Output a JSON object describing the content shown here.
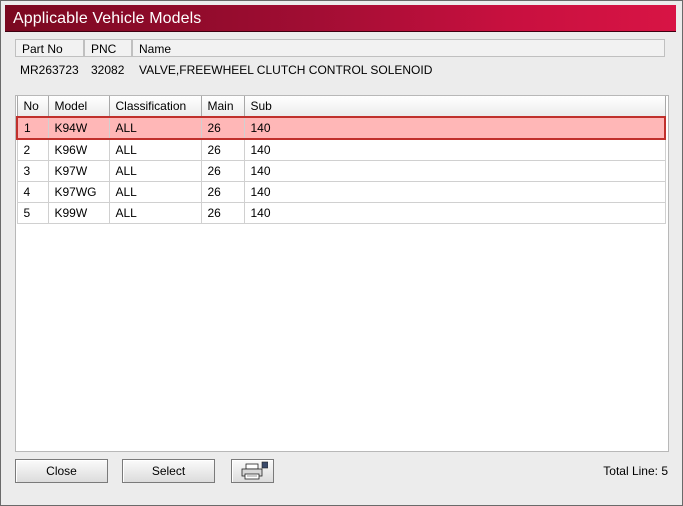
{
  "window": {
    "title": "Applicable Vehicle Models"
  },
  "part_header": {
    "columns": [
      "Part No",
      "PNC",
      "Name"
    ],
    "part_no": "MR263723",
    "pnc": "32082",
    "name": "VALVE,FREEWHEEL CLUTCH CONTROL SOLENOID"
  },
  "table": {
    "columns": [
      "No",
      "Model",
      "Classification",
      "Main",
      "Sub"
    ],
    "rows": [
      {
        "no": "1",
        "model": "K94W",
        "classification": "ALL",
        "main": "26",
        "sub": "140"
      },
      {
        "no": "2",
        "model": "K96W",
        "classification": "ALL",
        "main": "26",
        "sub": "140"
      },
      {
        "no": "3",
        "model": "K97W",
        "classification": "ALL",
        "main": "26",
        "sub": "140"
      },
      {
        "no": "4",
        "model": "K97WG",
        "classification": "ALL",
        "main": "26",
        "sub": "140"
      },
      {
        "no": "5",
        "model": "K99W",
        "classification": "ALL",
        "main": "26",
        "sub": "140"
      }
    ],
    "selected_row": 1
  },
  "footer": {
    "close_label": "Close",
    "select_label": "Select",
    "print_icon": "printer-icon",
    "total_line": "Total Line: 5"
  },
  "colors": {
    "title_gradient_start": "#7a0820",
    "title_gradient_end": "#d81445",
    "selected_row_bg": "#ffb7b7",
    "selected_row_border": "#c0302c"
  }
}
